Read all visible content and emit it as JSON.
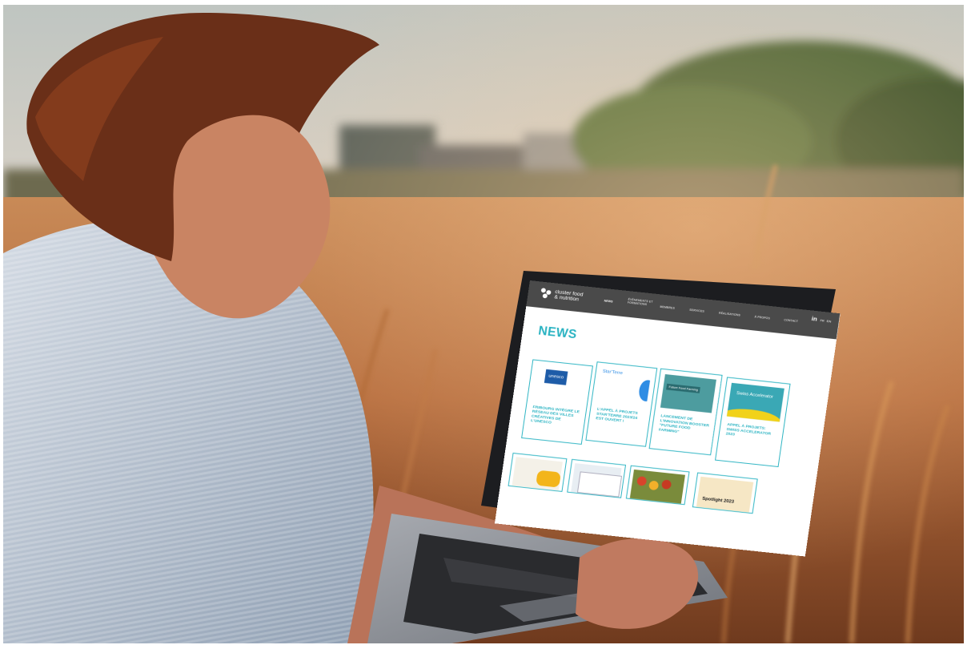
{
  "scene": {
    "colors": {
      "sky": "#c7cbc6",
      "field_light": "#d6a26a",
      "field_dark": "#6e3b1c",
      "trees": "#3f5f2e",
      "shirt": "#b7c3d2",
      "skin": "#c98463",
      "hair": "#5f2a14",
      "laptop_body": "#969aa1",
      "keyboard": "#2a2b2e"
    }
  },
  "website": {
    "logo": {
      "line1": "cluster food",
      "line2": "& nutrition"
    },
    "nav": [
      {
        "label": "NEWS",
        "active": true
      },
      {
        "label": "ÉVÉNEMENTS ET FORMATIONS"
      },
      {
        "label": "MEMBRES"
      },
      {
        "label": "SERVICES"
      },
      {
        "label": "RÉALISATIONS"
      },
      {
        "label": "À PROPOS"
      },
      {
        "label": "CONTACT"
      }
    ],
    "lang": {
      "fr": "FR",
      "en": "EN"
    },
    "social": {
      "linkedin": "in"
    },
    "heading": "NEWS",
    "cards": [
      {
        "title": "FRIBOURG INTÈGRE LE RÉSEAU DES VILLES CRÉATIVES DE L'UNESCO",
        "thumb_text": "unesco"
      },
      {
        "title": "L'APPEL À PROJETS STAR'TERRE 2023/24 EST OUVERT !",
        "thumb_text": "Star'Terre"
      },
      {
        "title": "LANCEMENT DE L'INNOVATION BOOSTER \"FUTURE FOOD FARMING\"",
        "thumb_text": "Future Food Farming"
      },
      {
        "title": "APPEL À PROJETS: SWISS ACCELERATOR 2023",
        "thumb_text": "Swiss Accelerator"
      }
    ],
    "small_cards": [
      {
        "label": ""
      },
      {
        "label": ""
      },
      {
        "label": ""
      },
      {
        "label": "Spotlight 2023"
      }
    ]
  }
}
